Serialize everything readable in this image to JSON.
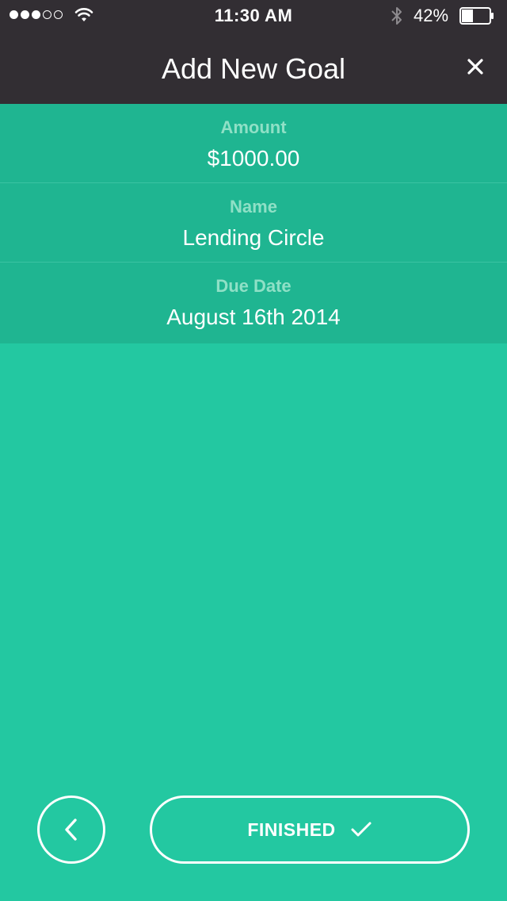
{
  "status_bar": {
    "time": "11:30 AM",
    "battery_percent": "42%",
    "signal_bars_filled": 3,
    "signal_bars_total": 5,
    "battery_level": 0.42,
    "icons": [
      "signal-dots-icon",
      "wifi-icon",
      "bluetooth-icon",
      "battery-icon"
    ]
  },
  "header": {
    "title": "Add New Goal",
    "close_icon": "close-icon"
  },
  "fields": [
    {
      "label": "Amount",
      "value": "$1000.00"
    },
    {
      "label": "Name",
      "value": "Lending Circle"
    },
    {
      "label": "Due Date",
      "value": "August 16th 2014"
    }
  ],
  "footer": {
    "back_icon": "chevron-left-icon",
    "finish_label": "FINISHED",
    "finish_icon": "checkmark-icon"
  },
  "colors": {
    "background": "#23c8a1",
    "field_background": "#1fb591",
    "header_background": "#322e33",
    "label_color": "#8fe0c6",
    "text_color": "#ffffff"
  }
}
